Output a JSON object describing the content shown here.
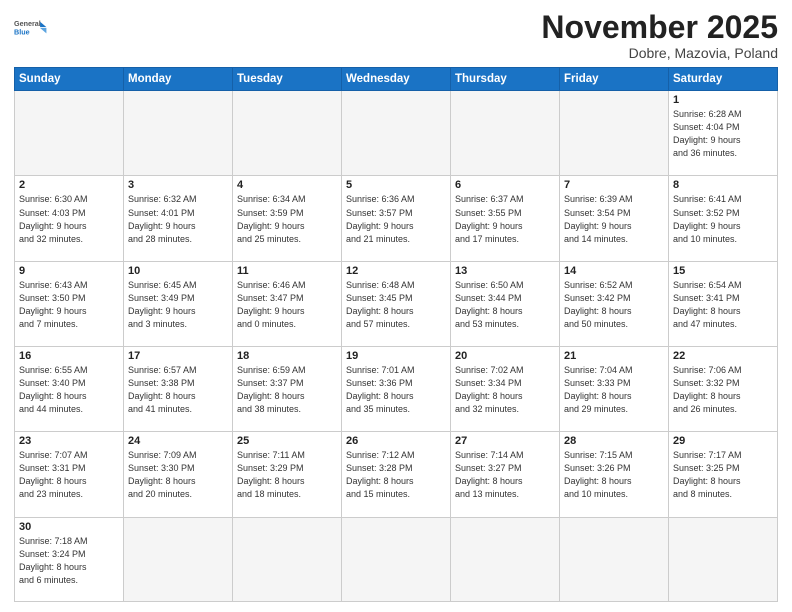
{
  "header": {
    "logo_general": "General",
    "logo_blue": "Blue",
    "month": "November 2025",
    "location": "Dobre, Mazovia, Poland"
  },
  "days_of_week": [
    "Sunday",
    "Monday",
    "Tuesday",
    "Wednesday",
    "Thursday",
    "Friday",
    "Saturday"
  ],
  "weeks": [
    [
      {
        "day": "",
        "empty": true
      },
      {
        "day": "",
        "empty": true
      },
      {
        "day": "",
        "empty": true
      },
      {
        "day": "",
        "empty": true
      },
      {
        "day": "",
        "empty": true
      },
      {
        "day": "",
        "empty": true
      },
      {
        "day": "1",
        "info": "Sunrise: 6:28 AM\nSunset: 4:04 PM\nDaylight: 9 hours\nand 36 minutes."
      }
    ],
    [
      {
        "day": "2",
        "info": "Sunrise: 6:30 AM\nSunset: 4:03 PM\nDaylight: 9 hours\nand 32 minutes."
      },
      {
        "day": "3",
        "info": "Sunrise: 6:32 AM\nSunset: 4:01 PM\nDaylight: 9 hours\nand 28 minutes."
      },
      {
        "day": "4",
        "info": "Sunrise: 6:34 AM\nSunset: 3:59 PM\nDaylight: 9 hours\nand 25 minutes."
      },
      {
        "day": "5",
        "info": "Sunrise: 6:36 AM\nSunset: 3:57 PM\nDaylight: 9 hours\nand 21 minutes."
      },
      {
        "day": "6",
        "info": "Sunrise: 6:37 AM\nSunset: 3:55 PM\nDaylight: 9 hours\nand 17 minutes."
      },
      {
        "day": "7",
        "info": "Sunrise: 6:39 AM\nSunset: 3:54 PM\nDaylight: 9 hours\nand 14 minutes."
      },
      {
        "day": "8",
        "info": "Sunrise: 6:41 AM\nSunset: 3:52 PM\nDaylight: 9 hours\nand 10 minutes."
      }
    ],
    [
      {
        "day": "9",
        "info": "Sunrise: 6:43 AM\nSunset: 3:50 PM\nDaylight: 9 hours\nand 7 minutes."
      },
      {
        "day": "10",
        "info": "Sunrise: 6:45 AM\nSunset: 3:49 PM\nDaylight: 9 hours\nand 3 minutes."
      },
      {
        "day": "11",
        "info": "Sunrise: 6:46 AM\nSunset: 3:47 PM\nDaylight: 9 hours\nand 0 minutes."
      },
      {
        "day": "12",
        "info": "Sunrise: 6:48 AM\nSunset: 3:45 PM\nDaylight: 8 hours\nand 57 minutes."
      },
      {
        "day": "13",
        "info": "Sunrise: 6:50 AM\nSunset: 3:44 PM\nDaylight: 8 hours\nand 53 minutes."
      },
      {
        "day": "14",
        "info": "Sunrise: 6:52 AM\nSunset: 3:42 PM\nDaylight: 8 hours\nand 50 minutes."
      },
      {
        "day": "15",
        "info": "Sunrise: 6:54 AM\nSunset: 3:41 PM\nDaylight: 8 hours\nand 47 minutes."
      }
    ],
    [
      {
        "day": "16",
        "info": "Sunrise: 6:55 AM\nSunset: 3:40 PM\nDaylight: 8 hours\nand 44 minutes."
      },
      {
        "day": "17",
        "info": "Sunrise: 6:57 AM\nSunset: 3:38 PM\nDaylight: 8 hours\nand 41 minutes."
      },
      {
        "day": "18",
        "info": "Sunrise: 6:59 AM\nSunset: 3:37 PM\nDaylight: 8 hours\nand 38 minutes."
      },
      {
        "day": "19",
        "info": "Sunrise: 7:01 AM\nSunset: 3:36 PM\nDaylight: 8 hours\nand 35 minutes."
      },
      {
        "day": "20",
        "info": "Sunrise: 7:02 AM\nSunset: 3:34 PM\nDaylight: 8 hours\nand 32 minutes."
      },
      {
        "day": "21",
        "info": "Sunrise: 7:04 AM\nSunset: 3:33 PM\nDaylight: 8 hours\nand 29 minutes."
      },
      {
        "day": "22",
        "info": "Sunrise: 7:06 AM\nSunset: 3:32 PM\nDaylight: 8 hours\nand 26 minutes."
      }
    ],
    [
      {
        "day": "23",
        "info": "Sunrise: 7:07 AM\nSunset: 3:31 PM\nDaylight: 8 hours\nand 23 minutes."
      },
      {
        "day": "24",
        "info": "Sunrise: 7:09 AM\nSunset: 3:30 PM\nDaylight: 8 hours\nand 20 minutes."
      },
      {
        "day": "25",
        "info": "Sunrise: 7:11 AM\nSunset: 3:29 PM\nDaylight: 8 hours\nand 18 minutes."
      },
      {
        "day": "26",
        "info": "Sunrise: 7:12 AM\nSunset: 3:28 PM\nDaylight: 8 hours\nand 15 minutes."
      },
      {
        "day": "27",
        "info": "Sunrise: 7:14 AM\nSunset: 3:27 PM\nDaylight: 8 hours\nand 13 minutes."
      },
      {
        "day": "28",
        "info": "Sunrise: 7:15 AM\nSunset: 3:26 PM\nDaylight: 8 hours\nand 10 minutes."
      },
      {
        "day": "29",
        "info": "Sunrise: 7:17 AM\nSunset: 3:25 PM\nDaylight: 8 hours\nand 8 minutes."
      }
    ],
    [
      {
        "day": "30",
        "info": "Sunrise: 7:18 AM\nSunset: 3:24 PM\nDaylight: 8 hours\nand 6 minutes.",
        "last": true
      },
      {
        "day": "",
        "empty": true,
        "last": true
      },
      {
        "day": "",
        "empty": true,
        "last": true
      },
      {
        "day": "",
        "empty": true,
        "last": true
      },
      {
        "day": "",
        "empty": true,
        "last": true
      },
      {
        "day": "",
        "empty": true,
        "last": true
      },
      {
        "day": "",
        "empty": true,
        "last": true
      }
    ]
  ]
}
